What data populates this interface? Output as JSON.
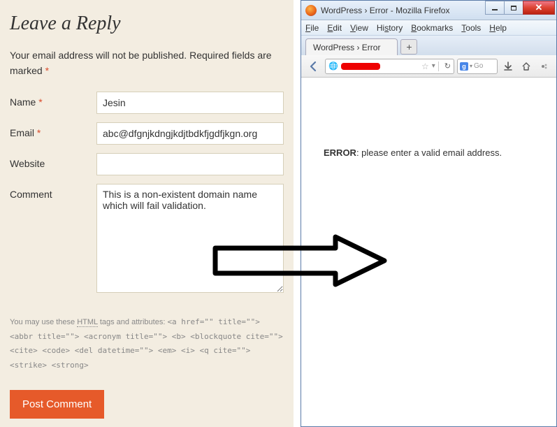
{
  "form": {
    "title": "Leave a Reply",
    "notice_pre": "Your email address will not be published. Required fields are marked ",
    "name_label": "Name ",
    "name_value": "Jesin",
    "email_label": "Email ",
    "email_value": "abc@dfgnjkdngjkdjtbdkfjgdfjkgn.org",
    "website_label": "Website",
    "website_value": "",
    "comment_label": "Comment",
    "comment_value": "This is a non-existent domain name which will fail validation.",
    "tags_pre": "You may use these ",
    "tags_html_word": "HTML",
    "tags_mid": " tags and attributes: ",
    "tags_code": "<a href=\"\" title=\"\"> <abbr title=\"\"> <acronym title=\"\"> <b> <blockquote cite=\"\"> <cite> <code> <del datetime=\"\"> <em> <i> <q cite=\"\"> <strike> <strong>",
    "submit": "Post Comment",
    "asterisk": "*"
  },
  "browser": {
    "window_title": "WordPress › Error - Mozilla Firefox",
    "menu": {
      "file": "File",
      "edit": "Edit",
      "view": "View",
      "history": "History",
      "bookmarks": "Bookmarks",
      "tools": "Tools",
      "help": "Help"
    },
    "tab_title": "WordPress › Error",
    "search_placeholder": "Go",
    "error_label": "ERROR",
    "error_msg": ": please enter a valid email address."
  }
}
